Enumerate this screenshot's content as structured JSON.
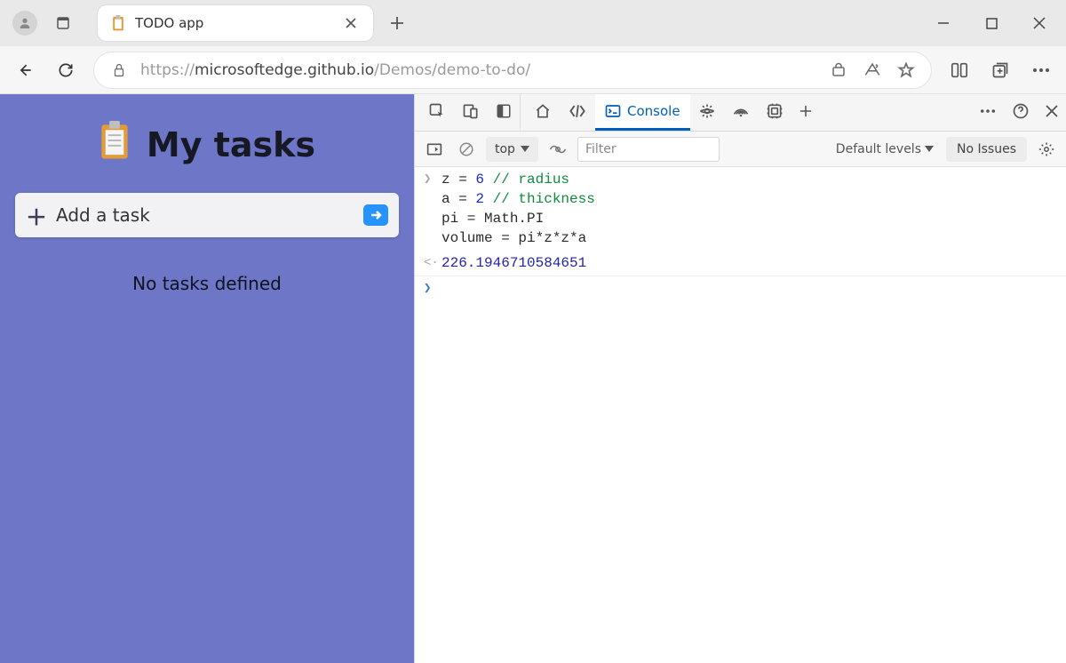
{
  "browser": {
    "tab": {
      "title": "TODO app"
    },
    "url": {
      "prefix": "https://",
      "host": "microsoftedge.github.io",
      "path": "/Demos/demo-to-do/"
    }
  },
  "page": {
    "title": "My tasks",
    "input_placeholder": "Add a task",
    "empty_text": "No tasks defined"
  },
  "devtools": {
    "tabs": {
      "console_label": "Console"
    },
    "toolbar": {
      "context": "top",
      "filter_placeholder": "Filter",
      "levels_label": "Default levels",
      "issues_label": "No Issues"
    },
    "console": {
      "input_lines": [
        {
          "segments": [
            {
              "t": "z = ",
              "c": "plain"
            },
            {
              "t": "6",
              "c": "num"
            },
            {
              "t": " // radius",
              "c": "com"
            }
          ]
        },
        {
          "segments": [
            {
              "t": "a = ",
              "c": "plain"
            },
            {
              "t": "2",
              "c": "num"
            },
            {
              "t": " // thickness",
              "c": "com"
            }
          ]
        },
        {
          "segments": [
            {
              "t": "pi = Math.PI",
              "c": "plain"
            }
          ]
        },
        {
          "segments": [
            {
              "t": "volume = pi*z*z*a",
              "c": "plain"
            }
          ]
        }
      ],
      "output": "226.1946710584651"
    }
  }
}
